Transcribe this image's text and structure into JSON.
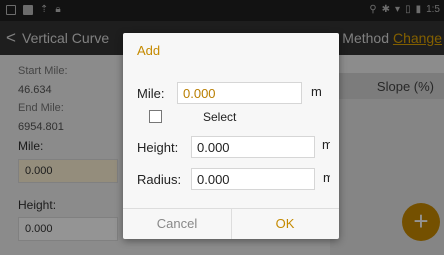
{
  "status_bar": {
    "time": "1:5"
  },
  "app_bar": {
    "back": "<",
    "title": "Vertical Curve",
    "method_label": "Method",
    "change_link": "Change"
  },
  "left_panel": {
    "start_mile_label": "Start Mile:",
    "start_mile_value": "46.634",
    "end_mile_label": "End Mile:",
    "end_mile_value": "6954.801",
    "mile_label": "Mile:",
    "mile_value": "0.000",
    "height_label": "Height:",
    "height_value": "0.000"
  },
  "table": {
    "slope_header": "Slope (%)"
  },
  "fab": {
    "label": "+"
  },
  "dialog": {
    "title": "Add",
    "mile_label": "Mile:",
    "mile_value": "0.000",
    "mile_unit": "m",
    "select_label": "Select",
    "height_label": "Height:",
    "height_value": "0.000",
    "height_unit": "m",
    "radius_label": "Radius:",
    "radius_value": "0.000",
    "radius_unit": "m",
    "cancel_label": "Cancel",
    "ok_label": "OK"
  },
  "colors": {
    "accent": "#c58a00",
    "appbar": "#353535",
    "statusbar": "#1f1f1f"
  }
}
